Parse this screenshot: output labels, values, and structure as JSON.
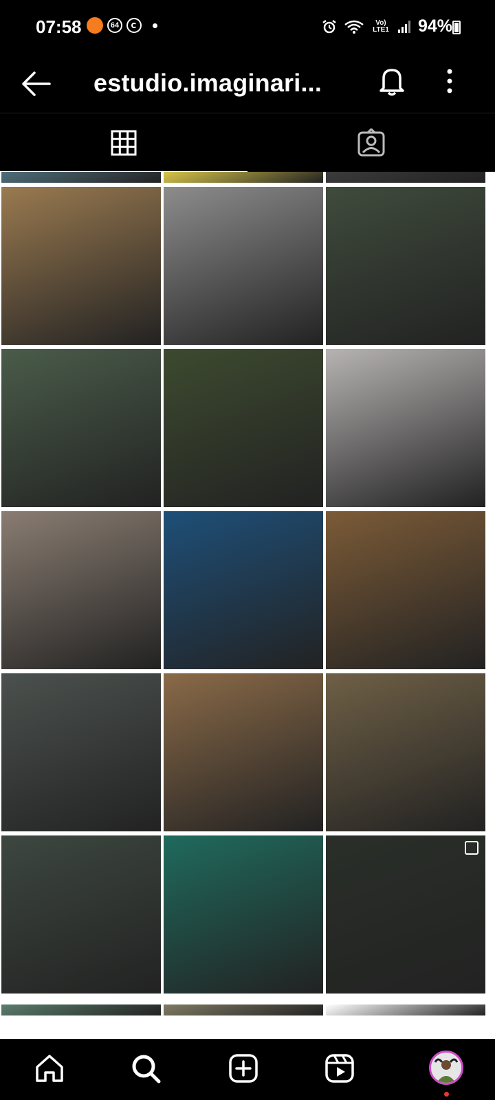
{
  "status_bar": {
    "time": "07:58",
    "notif_badge": "64",
    "network": "Vo) LTE1",
    "battery": "94%"
  },
  "header": {
    "title": "estudio.imaginari..."
  },
  "tabs": [
    {
      "name": "grid-tab",
      "icon": "grid-icon",
      "active": true
    },
    {
      "name": "tagged-tab",
      "icon": "tagged-person-icon",
      "active": false
    }
  ],
  "posts": [
    {
      "row": 0,
      "col": 0,
      "bg": "#4f6e79",
      "partial": true
    },
    {
      "row": 0,
      "col": 1,
      "bg": "#d7c54a",
      "partial": true
    },
    {
      "row": 0,
      "col": 2,
      "bg": "#3b3b3b",
      "partial": true
    },
    {
      "row": 1,
      "col": 0,
      "bg": "#9a7a50"
    },
    {
      "row": 1,
      "col": 1,
      "bg": "#8c8c8c"
    },
    {
      "row": 1,
      "col": 2,
      "bg": "#3f4b3c"
    },
    {
      "row": 2,
      "col": 0,
      "bg": "#4a5c4a"
    },
    {
      "row": 2,
      "col": 1,
      "bg": "#3d4a2f"
    },
    {
      "row": 2,
      "col": 2,
      "bg": "#b7b3b3"
    },
    {
      "row": 3,
      "col": 0,
      "bg": "#8a7d72"
    },
    {
      "row": 3,
      "col": 1,
      "bg": "#1e4f78"
    },
    {
      "row": 3,
      "col": 2,
      "bg": "#7c5b37"
    },
    {
      "row": 4,
      "col": 0,
      "bg": "#4b514e"
    },
    {
      "row": 4,
      "col": 1,
      "bg": "#8a6a48"
    },
    {
      "row": 4,
      "col": 2,
      "bg": "#6f6046"
    },
    {
      "row": 5,
      "col": 0,
      "bg": "#3d4740"
    },
    {
      "row": 5,
      "col": 1,
      "bg": "#1f6a5d"
    },
    {
      "row": 5,
      "col": 2,
      "bg": "#2a2f29",
      "multi": true
    },
    {
      "row": 6,
      "col": 0,
      "bg": "#5b7d6c",
      "partial": true
    },
    {
      "row": 6,
      "col": 1,
      "bg": "#7e7a63",
      "partial": true
    },
    {
      "row": 6,
      "col": 2,
      "bg": "#ffffff",
      "partial": true
    }
  ],
  "bottom_nav": [
    {
      "name": "home",
      "icon": "home-icon"
    },
    {
      "name": "search",
      "icon": "search-icon"
    },
    {
      "name": "create",
      "icon": "plus-square-icon"
    },
    {
      "name": "reels",
      "icon": "reels-icon"
    },
    {
      "name": "profile",
      "icon": "profile-avatar"
    }
  ]
}
